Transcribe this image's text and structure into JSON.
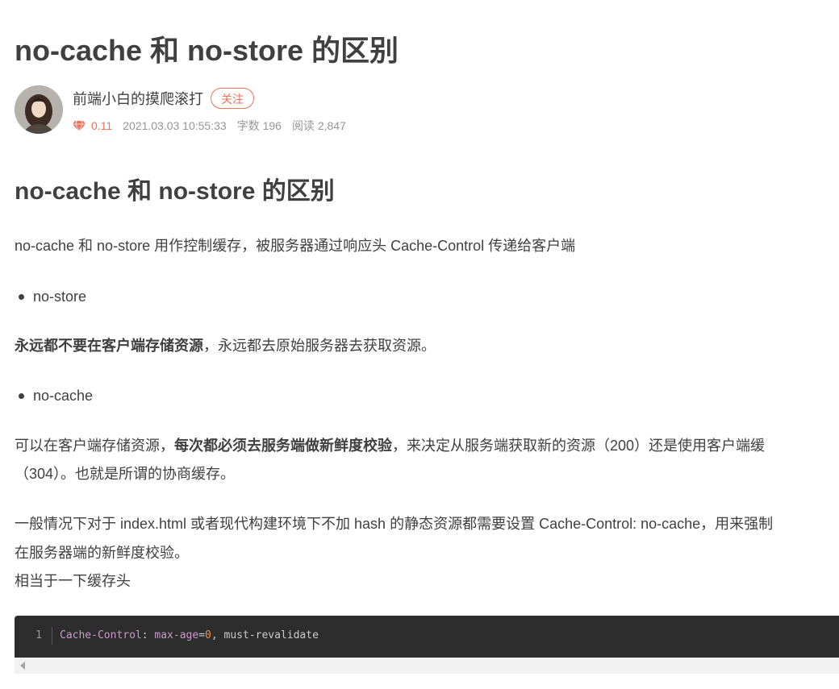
{
  "article": {
    "title": "no-cache 和 no-store 的区别",
    "author": {
      "name": "前端小白的摸爬滚打",
      "follow_label": "关注",
      "gem_value": "0.11",
      "date": "2021.03.03 10:55:33",
      "word_count": "字数 196",
      "reads": "阅读 2,847"
    },
    "heading": "no-cache 和 no-store 的区别",
    "intro": "no-cache 和 no-store 用作控制缓存，被服务器通过响应头 Cache-Control 传递给客户端",
    "list1": "no-store",
    "store_desc_bold": "永远都不要在客户端存储资源",
    "store_desc_rest": "，永远都去原始服务器去获取资源。",
    "list2": "no-cache",
    "cache_desc_start": "可以在客户端存储资源，",
    "cache_desc_bold": "每次都必须去服务端做新鲜度校验",
    "cache_desc_end": "，来决定从服务端获取新的资源（200）还是使用客户端缓",
    "cache_desc_line2": "（304）。也就是所谓的协商缓存。",
    "general_line1": "一般情况下对于 index.html 或者现代构建环境下不加 hash 的静态资源都需要设置 Cache-Control: no-cache，用来强制",
    "general_line2": "在服务器端的新鲜度校验。",
    "equivalent": "相当于一下缓存头",
    "code": {
      "line_number": "1",
      "prop": "Cache-Control",
      "colon": ": ",
      "key": "max-age",
      "eq": "=",
      "num": "0",
      "rest": ", must-revalidate"
    }
  },
  "colors": {
    "accent": "#ec7259",
    "text": "#404040",
    "muted": "#969696",
    "code_bg": "#2d2d2d"
  },
  "icons": {
    "gem": "gem-icon",
    "avatar": "avatar"
  }
}
